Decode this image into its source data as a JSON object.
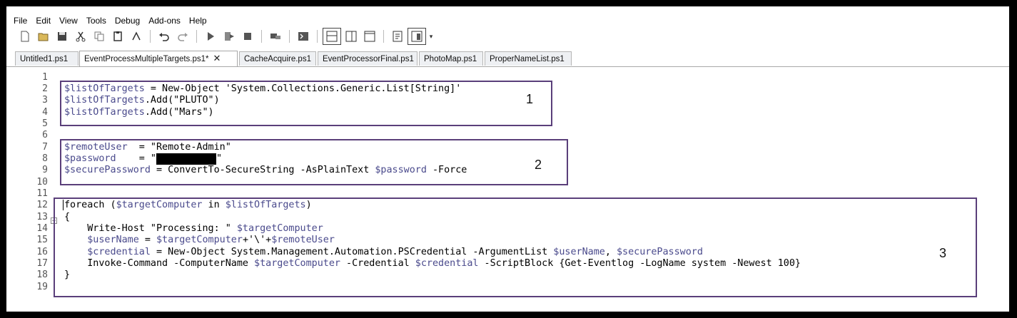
{
  "menu": [
    "File",
    "Edit",
    "View",
    "Tools",
    "Debug",
    "Add-ons",
    "Help"
  ],
  "tabs": [
    {
      "label": "Untitled1.ps1",
      "active": false
    },
    {
      "label": "EventProcessMultipleTargets.ps1*",
      "active": true,
      "close": "✕"
    },
    {
      "label": "CacheAcquire.ps1",
      "active": false
    },
    {
      "label": "EventProcessorFinal.ps1",
      "active": false
    },
    {
      "label": "PhotoMap.ps1",
      "active": false
    },
    {
      "label": "ProperNameList.ps1",
      "active": false
    }
  ],
  "toolbar_icons": [
    "new-icon",
    "open-icon",
    "save-icon",
    "cut-icon",
    "copy-icon",
    "paste-icon",
    "clear-icon",
    "undo-icon",
    "redo-icon",
    "run-icon",
    "run-selection-icon",
    "stop-icon",
    "remote-icon",
    "powershell-icon",
    "layout-top-icon",
    "layout-right-icon",
    "layout-max-icon",
    "command-icon",
    "addon-icon"
  ],
  "line_numbers": [
    "1",
    "2",
    "3",
    "4",
    "5",
    "6",
    "7",
    "8",
    "9",
    "10",
    "11",
    "12",
    "13",
    "14",
    "15",
    "16",
    "17",
    "18",
    "19"
  ],
  "code": {
    "l2a": "$listOfTargets",
    "l2b": " = New-Object 'System.Collections.Generic.List[String]'",
    "l3a": "$listOfTargets",
    "l3b": ".Add(\"PLUTO\")",
    "l4a": "$listOfTargets",
    "l4b": ".Add(\"Mars\")",
    "l7a": "$remoteUser",
    "l7b": "  = \"Remote-Admin\"",
    "l8a": "$password",
    "l8b": "    = \"",
    "l8c": "\"",
    "l9a": "$securePassword",
    "l9b": " = ConvertTo-SecureString -AsPlainText ",
    "l9c": "$password",
    "l9d": " -Force",
    "l12a": "foreach (",
    "l12b": "$targetComputer",
    "l12c": " in ",
    "l12d": "$listOfTargets",
    "l12e": ")",
    "l13": "{",
    "l14a": "    Write-Host \"Processing: \" ",
    "l14b": "$targetComputer",
    "l15a": "    ",
    "l15b": "$userName",
    "l15c": " = ",
    "l15d": "$targetComputer",
    "l15e": "+'\\'+",
    "l15f": "$remoteUser",
    "l16a": "    ",
    "l16b": "$credential",
    "l16c": " = New-Object System.Management.Automation.PSCredential -ArgumentList ",
    "l16d": "$userName",
    "l16e": ", ",
    "l16f": "$securePassword",
    "l17a": "    Invoke-Command -ComputerName ",
    "l17b": "$targetComputer",
    "l17c": " -Credential ",
    "l17d": "$credential",
    "l17e": " -ScriptBlock {Get-Eventlog -LogName system -Newest 100}",
    "l18": "}"
  },
  "annotations": [
    "1",
    "2",
    "3"
  ]
}
